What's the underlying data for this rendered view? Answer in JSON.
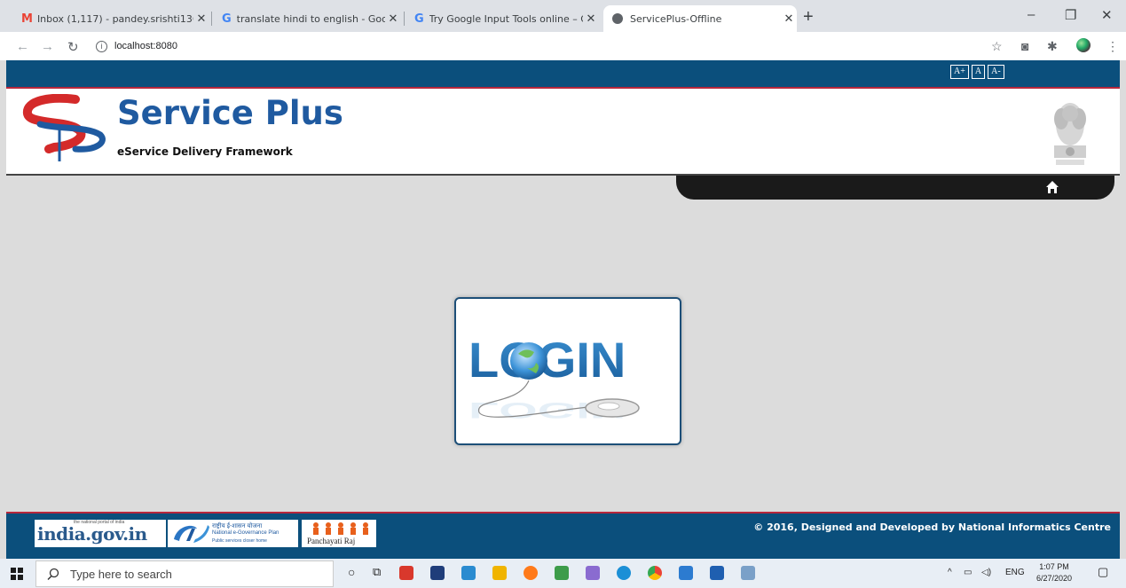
{
  "browser": {
    "tabs": [
      {
        "title": "Inbox (1,117) - pandey.srishti136",
        "icon": "gmail-icon"
      },
      {
        "title": "translate hindi to english - Goog",
        "icon": "google-icon"
      },
      {
        "title": "Try Google Input Tools online – G",
        "icon": "google-icon"
      },
      {
        "title": "ServicePlus-Offline",
        "icon": "globe-icon",
        "active": true
      }
    ],
    "new_tab": "+",
    "url": "localhost:8080",
    "window_controls": [
      "–",
      "❐",
      "✕"
    ]
  },
  "page": {
    "font_buttons": [
      "A+",
      "A",
      "A-"
    ],
    "brand": "Service Plus",
    "tagline": "eService Delivery Framework",
    "login_text": "LOGIN",
    "footer": {
      "copyright": "© 2016, Designed and Developed by National Informatics Centre",
      "logos": {
        "indiagov_main": "india.gov.in",
        "indiagov_small": "the national portal of india",
        "negp_line1": "राष्ट्रीय ई-शासन योजना",
        "negp_line2": "National e-Governance Plan",
        "negp_line3": "Public services closer home",
        "panchayat": "Panchayati Raj"
      }
    }
  },
  "taskbar": {
    "search_placeholder": "Type here to search",
    "language": "ENG",
    "time": "1:07 PM",
    "date": "6/27/2020"
  },
  "colors": {
    "brand_blue": "#1f5aa0",
    "band_navy": "#0b4f7c",
    "accent_red": "#b7273b"
  }
}
